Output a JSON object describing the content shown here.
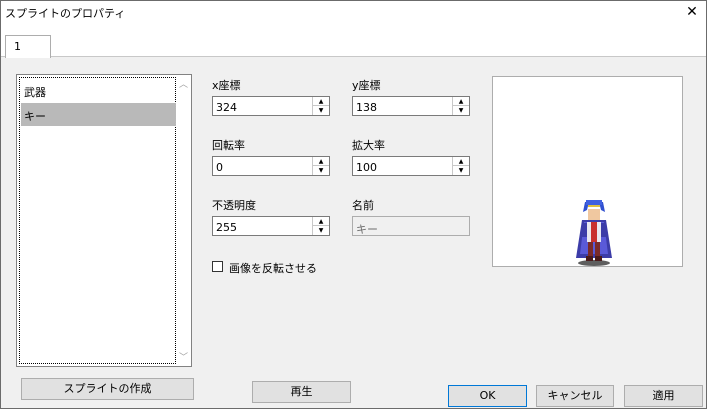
{
  "window": {
    "title": "スプライトのプロパティ",
    "close_glyph": "✕"
  },
  "tabs": [
    {
      "label": "1"
    }
  ],
  "list": {
    "items": [
      {
        "label": "武器"
      },
      {
        "label": "キー"
      }
    ],
    "selected_index": 1
  },
  "fields": {
    "x": {
      "label": "x座標",
      "value": "324"
    },
    "y": {
      "label": "y座標",
      "value": "138"
    },
    "rotation": {
      "label": "回転率",
      "value": "0"
    },
    "scale": {
      "label": "拡大率",
      "value": "100"
    },
    "opacity": {
      "label": "不透明度",
      "value": "255"
    },
    "name": {
      "label": "名前",
      "value": "キー"
    }
  },
  "flip_checkbox": {
    "label": "画像を反転させる",
    "checked": false
  },
  "buttons": {
    "create_sprite": "スプライトの作成",
    "play": "再生",
    "ok": "OK",
    "cancel": "キャンセル",
    "apply": "適用"
  },
  "preview": {
    "image": "sprite-character-blue-hair-caped-lord"
  }
}
